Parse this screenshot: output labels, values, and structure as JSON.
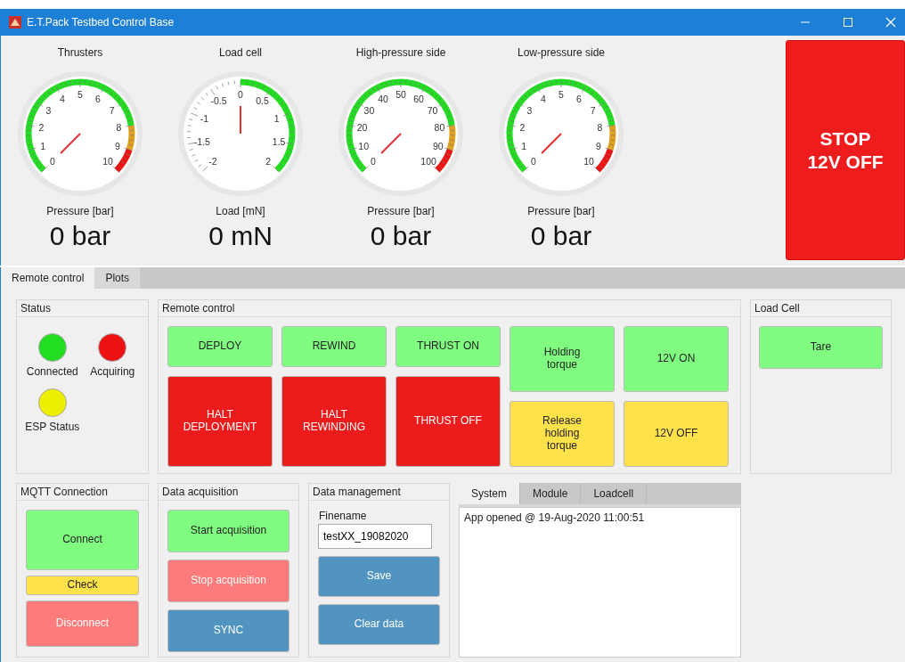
{
  "window": {
    "title": "E.T.Pack Testbed Control Base"
  },
  "gauges": [
    {
      "title": "Thrusters",
      "kind": "unipolar",
      "ticks": [
        "0",
        "1",
        "2",
        "3",
        "4",
        "5",
        "6",
        "7",
        "8",
        "9",
        "10"
      ],
      "bands": [
        {
          "color": "#22dd22"
        },
        {
          "color": "#22dd22"
        },
        {
          "color": "#22dd22"
        },
        {
          "color": "#22dd22"
        },
        {
          "color": "#22dd22"
        },
        {
          "color": "#22dd22"
        },
        {
          "color": "#22dd22"
        },
        {
          "color": "#22dd22"
        },
        {
          "color": "#e0a020"
        },
        {
          "color": "#ee1111"
        }
      ],
      "axis_label": "Pressure [bar]",
      "reading": "0 bar"
    },
    {
      "title": "Load cell",
      "kind": "bipolar",
      "ticks": [
        "-2",
        "-1.5",
        "-1",
        "-0.5",
        "0",
        "0.5",
        "1",
        "1.5",
        "2"
      ],
      "bands": [
        {
          "color": "#22dd22"
        },
        {
          "color": "#22dd22"
        },
        {
          "color": "#22dd22"
        },
        {
          "color": "#22dd22"
        }
      ],
      "axis_label": "Load [mN]",
      "reading": "0 mN"
    },
    {
      "title": "High-pressure side",
      "kind": "unipolar",
      "ticks": [
        "0",
        "10",
        "20",
        "30",
        "40",
        "50",
        "60",
        "70",
        "80",
        "90",
        "100"
      ],
      "bands": [
        {
          "color": "#22dd22"
        },
        {
          "color": "#22dd22"
        },
        {
          "color": "#22dd22"
        },
        {
          "color": "#22dd22"
        },
        {
          "color": "#22dd22"
        },
        {
          "color": "#22dd22"
        },
        {
          "color": "#22dd22"
        },
        {
          "color": "#22dd22"
        },
        {
          "color": "#e0a020"
        },
        {
          "color": "#ee1111"
        }
      ],
      "axis_label": "Pressure [bar]",
      "reading": "0 bar"
    },
    {
      "title": "Low-pressure side",
      "kind": "unipolar",
      "ticks": [
        "0",
        "1",
        "2",
        "3",
        "4",
        "5",
        "6",
        "7",
        "8",
        "9",
        "10"
      ],
      "bands": [
        {
          "color": "#22dd22"
        },
        {
          "color": "#22dd22"
        },
        {
          "color": "#22dd22"
        },
        {
          "color": "#22dd22"
        },
        {
          "color": "#22dd22"
        },
        {
          "color": "#22dd22"
        },
        {
          "color": "#22dd22"
        },
        {
          "color": "#22dd22"
        },
        {
          "color": "#e0a020"
        },
        {
          "color": "#ee1111"
        }
      ],
      "axis_label": "Pressure [bar]",
      "reading": "0 bar"
    }
  ],
  "stop_button": {
    "label": "STOP\n12V OFF"
  },
  "tabs": [
    {
      "label": "Remote control",
      "selected": true
    },
    {
      "label": "Plots",
      "selected": false
    }
  ],
  "status": {
    "title": "Status",
    "lamps": [
      {
        "label": "Connected",
        "color": "#22dd22"
      },
      {
        "label": "Acquiring",
        "color": "#ee1111"
      },
      {
        "label": "ESP Status",
        "color": "#eeee00"
      }
    ]
  },
  "remote_control": {
    "title": "Remote control",
    "buttons": [
      {
        "label": "DEPLOY",
        "color": "#80fc80",
        "kind": "short"
      },
      {
        "label": "REWIND",
        "color": "#80fc80",
        "kind": "short"
      },
      {
        "label": "THRUST ON",
        "color": "#80fc80",
        "kind": "short"
      },
      {
        "label": "Holding\ntorque",
        "color": "#80fc80",
        "kind": "half"
      },
      {
        "label": "12V ON",
        "color": "#80fc80",
        "kind": "half"
      },
      {
        "label": "HALT\nDEPLOYMENT",
        "color": "#ed1c1c",
        "kind": "tall"
      },
      {
        "label": "HALT\nREWINDING",
        "color": "#ed1c1c",
        "kind": "tall"
      },
      {
        "label": "THRUST OFF",
        "color": "#ed1c1c",
        "kind": "tall"
      },
      {
        "label": "Release\nholding\ntorque",
        "color": "#ffe14a",
        "kind": "half"
      },
      {
        "label": "12V OFF",
        "color": "#ffe14a",
        "kind": "half"
      }
    ]
  },
  "load_cell": {
    "title": "Load Cell",
    "buttons": [
      {
        "label": "Tare",
        "color": "#80fc80"
      }
    ]
  },
  "mqtt": {
    "title": "MQTT Connection",
    "buttons": [
      {
        "label": "Connect",
        "color": "#80fc80",
        "kind": "big"
      },
      {
        "label": "Check",
        "color": "#ffe14a",
        "kind": "thin"
      },
      {
        "label": "Disconnect",
        "color": "#ff7b7b",
        "kind": "normal"
      }
    ]
  },
  "data_acquisition": {
    "title": "Data acquisition",
    "buttons": [
      {
        "label": "Start acquisition",
        "color": "#80fc80"
      },
      {
        "label": "Stop acquisition",
        "color": "#ff7b7b"
      },
      {
        "label": "SYNC",
        "color": "#5294c0"
      }
    ]
  },
  "data_management": {
    "title": "Data management",
    "field": {
      "label": "Finename",
      "value": "testXX_19082020"
    },
    "buttons": [
      {
        "label": "Save",
        "color": "#5294c0"
      },
      {
        "label": "Clear data",
        "color": "#5294c0"
      }
    ]
  },
  "log": {
    "tabs": [
      {
        "label": "System",
        "selected": true
      },
      {
        "label": "Module",
        "selected": false
      },
      {
        "label": "Loadcell",
        "selected": false
      }
    ],
    "lines": [
      "App opened @ 19-Aug-2020 11:00:51"
    ]
  }
}
